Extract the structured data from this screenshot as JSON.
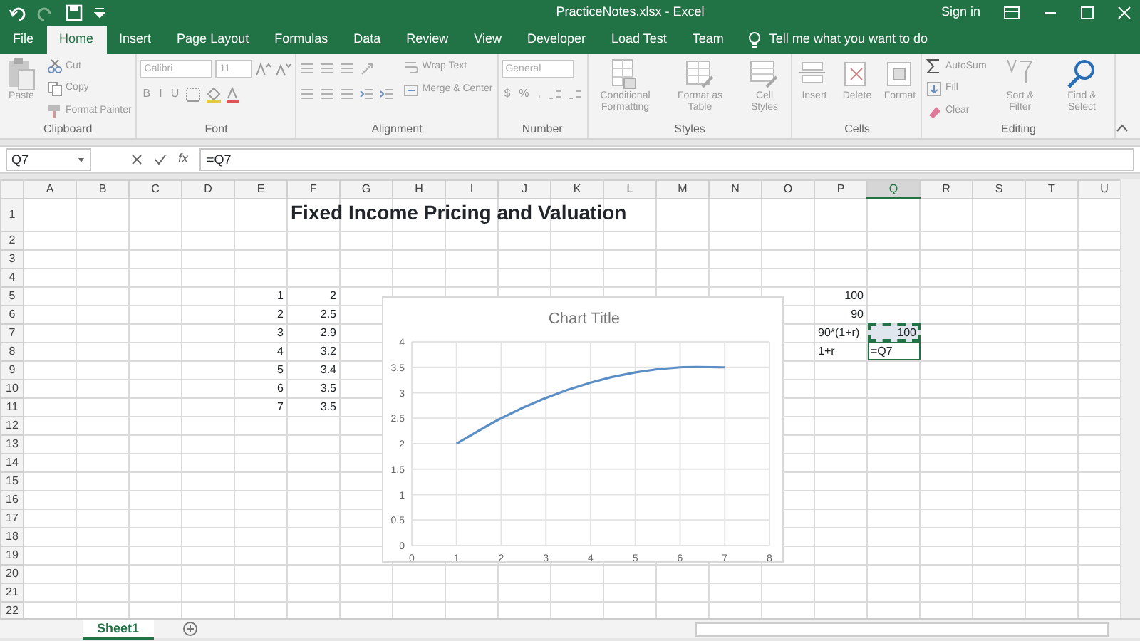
{
  "window": {
    "title": "PracticeNotes.xlsx - Excel",
    "sign_in": "Sign in"
  },
  "tabs": [
    {
      "label": "File",
      "selected": false
    },
    {
      "label": "Home",
      "selected": true
    },
    {
      "label": "Insert",
      "selected": false
    },
    {
      "label": "Page Layout",
      "selected": false
    },
    {
      "label": "Formulas",
      "selected": false
    },
    {
      "label": "Data",
      "selected": false
    },
    {
      "label": "Review",
      "selected": false
    },
    {
      "label": "View",
      "selected": false
    },
    {
      "label": "Developer",
      "selected": false
    },
    {
      "label": "Load Test",
      "selected": false
    },
    {
      "label": "Team",
      "selected": false
    }
  ],
  "tell_me": {
    "placeholder": "Tell me what you want to do"
  },
  "ribbon": {
    "groups": [
      {
        "label": "Clipboard",
        "columns": [
          [
            {
              "kind": "large",
              "label": "Paste"
            }
          ],
          [
            {
              "kind": "small",
              "label": "Cut"
            },
            {
              "kind": "small",
              "label": "Copy"
            },
            {
              "kind": "small",
              "label": "Format Painter"
            }
          ]
        ]
      },
      {
        "label": "Font",
        "columns": [
          [
            {
              "kind": "row",
              "items": [
                {
                  "kind": "field",
                  "value": "Calibri"
                },
                {
                  "kind": "field",
                  "value": "11"
                },
                {
                  "kind": "icon"
                },
                {
                  "kind": "icon"
                }
              ]
            },
            {
              "kind": "row",
              "items": [
                {
                  "kind": "glyph",
                  "text": "B"
                },
                {
                  "kind": "glyph",
                  "text": "I"
                },
                {
                  "kind": "glyph",
                  "text": "U"
                },
                {
                  "kind": "icon"
                },
                {
                  "kind": "icon"
                },
                {
                  "kind": "icon"
                }
              ]
            }
          ]
        ]
      },
      {
        "label": "Alignment",
        "columns": [
          [
            {
              "kind": "row",
              "items": [
                {
                  "kind": "icon"
                },
                {
                  "kind": "icon"
                },
                {
                  "kind": "icon"
                },
                {
                  "kind": "icon"
                }
              ]
            },
            {
              "kind": "row",
              "items": [
                {
                  "kind": "icon"
                },
                {
                  "kind": "icon"
                },
                {
                  "kind": "icon"
                },
                {
                  "kind": "icon"
                },
                {
                  "kind": "icon"
                }
              ]
            }
          ],
          [
            {
              "kind": "small",
              "label": "Wrap Text"
            },
            {
              "kind": "small",
              "label": "Merge & Center"
            }
          ]
        ]
      },
      {
        "label": "Number",
        "columns": [
          [
            {
              "kind": "row",
              "items": [
                {
                  "kind": "field",
                  "value": "General"
                }
              ]
            },
            {
              "kind": "row",
              "items": [
                {
                  "kind": "glyph",
                  "text": "$"
                },
                {
                  "kind": "glyph",
                  "text": "%"
                },
                {
                  "kind": "glyph",
                  "text": ","
                },
                {
                  "kind": "icon"
                },
                {
                  "kind": "icon"
                }
              ]
            }
          ]
        ]
      },
      {
        "label": "Styles",
        "columns": [
          [
            {
              "kind": "large",
              "label": "Conditional Formatting"
            }
          ],
          [
            {
              "kind": "large",
              "label": "Format as Table"
            }
          ],
          [
            {
              "kind": "large",
              "label": "Cell Styles"
            }
          ]
        ]
      },
      {
        "label": "Cells",
        "columns": [
          [
            {
              "kind": "large",
              "label": "Insert"
            }
          ],
          [
            {
              "kind": "large",
              "label": "Delete"
            }
          ],
          [
            {
              "kind": "large",
              "label": "Format"
            }
          ]
        ]
      },
      {
        "label": "Editing",
        "columns": [
          [
            {
              "kind": "small",
              "label": "AutoSum"
            },
            {
              "kind": "small",
              "label": "Fill"
            },
            {
              "kind": "small",
              "label": "Clear"
            }
          ],
          [
            {
              "kind": "large",
              "label": "Sort & Filter"
            }
          ],
          [
            {
              "kind": "large",
              "label": "Find & Select"
            }
          ]
        ]
      }
    ]
  },
  "formula_bar": {
    "name_box": "Q7",
    "function_label": "fx",
    "formula": "=Q7"
  },
  "columns": [
    {
      "label": "A",
      "selected": false
    },
    {
      "label": "B",
      "selected": false
    },
    {
      "label": "C",
      "selected": false
    },
    {
      "label": "D",
      "selected": false
    },
    {
      "label": "E",
      "selected": false
    },
    {
      "label": "F",
      "selected": false
    },
    {
      "label": "G",
      "selected": false
    },
    {
      "label": "H",
      "selected": false
    },
    {
      "label": "I",
      "selected": false
    },
    {
      "label": "J",
      "selected": false
    },
    {
      "label": "K",
      "selected": false
    },
    {
      "label": "L",
      "selected": false
    },
    {
      "label": "M",
      "selected": false
    },
    {
      "label": "N",
      "selected": false
    },
    {
      "label": "O",
      "selected": false
    },
    {
      "label": "P",
      "selected": false
    },
    {
      "label": "Q",
      "selected": true
    },
    {
      "label": "R",
      "selected": false
    },
    {
      "label": "S",
      "selected": false
    },
    {
      "label": "T",
      "selected": false
    },
    {
      "label": "U",
      "selected": false
    }
  ],
  "rows": [
    {
      "label": "1",
      "cells": {
        "F": {
          "text": "Fixed Income Pricing and Valuation",
          "kind": "title"
        }
      }
    },
    {
      "label": "2"
    },
    {
      "label": "3"
    },
    {
      "label": "4"
    },
    {
      "label": "5",
      "cells": {
        "E": {
          "text": "1",
          "kind": "number"
        },
        "F": {
          "text": "2",
          "kind": "number"
        },
        "P": {
          "text": "100",
          "kind": "number"
        }
      }
    },
    {
      "label": "6",
      "cells": {
        "E": {
          "text": "2",
          "kind": "number"
        },
        "F": {
          "text": "2.5",
          "kind": "number"
        },
        "P": {
          "text": "90",
          "kind": "number"
        }
      }
    },
    {
      "label": "7",
      "cells": {
        "E": {
          "text": "3",
          "kind": "number"
        },
        "F": {
          "text": "2.9",
          "kind": "number"
        },
        "P": {
          "text": "90*(1+r)",
          "kind": "text"
        },
        "Q": {
          "text": "100",
          "kind": "number",
          "marquee": true
        }
      }
    },
    {
      "label": "8",
      "cells": {
        "E": {
          "text": "4",
          "kind": "number"
        },
        "F": {
          "text": "3.2",
          "kind": "number"
        },
        "P": {
          "text": "1+r",
          "kind": "text"
        },
        "Q": {
          "text": "=Q7",
          "kind": "text",
          "editing": true
        }
      }
    },
    {
      "label": "9",
      "cells": {
        "E": {
          "text": "5",
          "kind": "number"
        },
        "F": {
          "text": "3.4",
          "kind": "number"
        }
      }
    },
    {
      "label": "10",
      "cells": {
        "E": {
          "text": "6",
          "kind": "number"
        },
        "F": {
          "text": "3.5",
          "kind": "number"
        }
      }
    },
    {
      "label": "11",
      "cells": {
        "E": {
          "text": "7",
          "kind": "number"
        },
        "F": {
          "text": "3.5",
          "kind": "number"
        }
      }
    },
    {
      "label": "12"
    },
    {
      "label": "13"
    },
    {
      "label": "14"
    },
    {
      "label": "15"
    },
    {
      "label": "16"
    },
    {
      "label": "17"
    },
    {
      "label": "18"
    },
    {
      "label": "19"
    },
    {
      "label": "20"
    },
    {
      "label": "21"
    },
    {
      "label": "22"
    }
  ],
  "chart": {
    "chart_data": {
      "type": "line",
      "title": "Chart Title",
      "x": [
        1,
        2,
        3,
        4,
        5,
        6,
        7
      ],
      "series": [
        {
          "color": "#5b8ec4",
          "values": [
            2,
            2.5,
            2.9,
            3.2,
            3.4,
            3.5,
            3.5
          ]
        }
      ],
      "grid": true,
      "xlim": [
        0,
        8
      ],
      "ylim": [
        0,
        4
      ],
      "xticks": [
        {
          "value": 0,
          "label": "0"
        },
        {
          "value": 1,
          "label": "1"
        },
        {
          "value": 2,
          "label": "2"
        },
        {
          "value": 3,
          "label": "3"
        },
        {
          "value": 4,
          "label": "4"
        },
        {
          "value": 5,
          "label": "5"
        },
        {
          "value": 6,
          "label": "6"
        },
        {
          "value": 7,
          "label": "7"
        },
        {
          "value": 8,
          "label": "8"
        }
      ],
      "yticks": [
        {
          "value": 0,
          "label": "0"
        },
        {
          "value": 0.5,
          "label": "0.5"
        },
        {
          "value": 1,
          "label": "1"
        },
        {
          "value": 1.5,
          "label": "1.5"
        },
        {
          "value": 2,
          "label": "2"
        },
        {
          "value": 2.5,
          "label": "2.5"
        },
        {
          "value": 3,
          "label": "3"
        },
        {
          "value": 3.5,
          "label": "3.5"
        },
        {
          "value": 4,
          "label": "4"
        }
      ]
    }
  },
  "sheet_tabs": [
    {
      "label": "Sheet1",
      "selected": true
    }
  ]
}
